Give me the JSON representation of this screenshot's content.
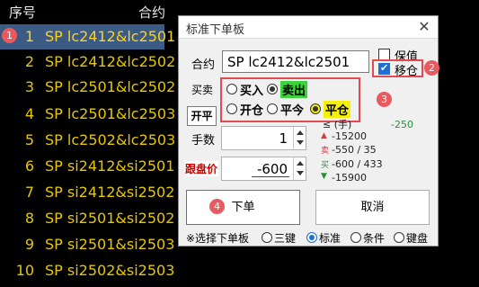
{
  "list": {
    "header_seq": "序号",
    "header_contract": "合约",
    "rows": [
      {
        "num": "1",
        "name": "SP lc2412&lc2501",
        "selected": true
      },
      {
        "num": "2",
        "name": "SP lc2412&lc2502"
      },
      {
        "num": "3",
        "name": "SP lc2501&lc2502"
      },
      {
        "num": "4",
        "name": "SP lc2501&lc2503"
      },
      {
        "num": "5",
        "name": "SP lc2502&lc2503"
      },
      {
        "num": "6",
        "name": "SP si2412&si2501"
      },
      {
        "num": "7",
        "name": "SP si2412&si2502"
      },
      {
        "num": "8",
        "name": "SP si2501&si2502"
      },
      {
        "num": "9",
        "name": "SP si2501&si2503"
      },
      {
        "num": "10",
        "name": "SP si2502&si2503"
      }
    ]
  },
  "badges": {
    "b1": "1",
    "b2": "2",
    "b3": "3",
    "b4": "4"
  },
  "dialog": {
    "title": "标准下单板",
    "close": "✕",
    "contract_label": "合约",
    "contract_value": "SP lc2412&lc2501",
    "baozhi_label": "保值",
    "baozhi_checked": false,
    "yicang_label": "移仓",
    "yicang_checked": true,
    "maimai_label": "买卖",
    "buy_label": "买入",
    "sell_label": "卖出",
    "kaiping_button": "开平",
    "open_label": "开仓",
    "close_today_label": "平今",
    "close_label": "平仓",
    "qty_label": "手数",
    "qty_value": "1",
    "gen_pan_label": "跟盘价",
    "price_value": "-600",
    "info": {
      "line1": "≤ (手)",
      "line1_extra": "-250",
      "line2": "-15200",
      "line3": "-550 / 35",
      "line4": "-600 / 433",
      "line5": "-15900"
    },
    "order_button": "下单",
    "cancel_button": "取消",
    "mode_label": "※选择下单板",
    "modes": [
      "三键",
      "标准",
      "条件",
      "键盘"
    ],
    "selected_mode": "标准"
  },
  "colors": {
    "list_text": "#e6c700",
    "selected_row": "#3b5a84",
    "highlight_red": "#e34a52",
    "sell_highlight": "#3cd33c",
    "close_highlight": "#f5f00a"
  }
}
